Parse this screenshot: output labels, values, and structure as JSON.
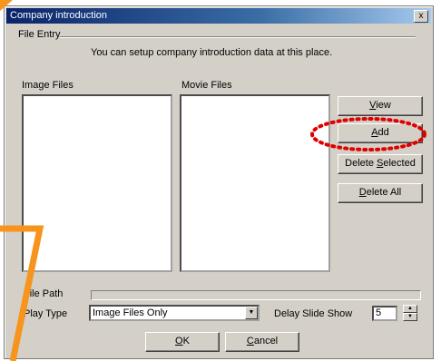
{
  "window": {
    "title": "Company introduction",
    "close_label": "x"
  },
  "group": {
    "label": "File Entry",
    "info_text": "You can setup company introduction data at this place."
  },
  "lists": {
    "image_label": "Image Files",
    "movie_label": "Movie Files"
  },
  "buttons": {
    "view": {
      "accel": "V",
      "rest": "iew"
    },
    "add": {
      "accel": "A",
      "rest": "dd"
    },
    "delete_selected": {
      "pre": "Delete ",
      "accel": "S",
      "rest": "elected"
    },
    "delete_all": {
      "accel": "D",
      "rest": "elete All"
    },
    "ok": {
      "accel": "O",
      "rest": "K"
    },
    "cancel": {
      "accel": "C",
      "rest": "ancel"
    }
  },
  "file_path": {
    "label": "File Path",
    "value": ""
  },
  "play_type": {
    "label": "Play Type",
    "value": "Image Files Only"
  },
  "delay": {
    "label": "Delay Slide Show",
    "value": "5"
  },
  "annotation": {
    "highlight_color": "#e00000",
    "pointer_color": "#f7941d"
  }
}
